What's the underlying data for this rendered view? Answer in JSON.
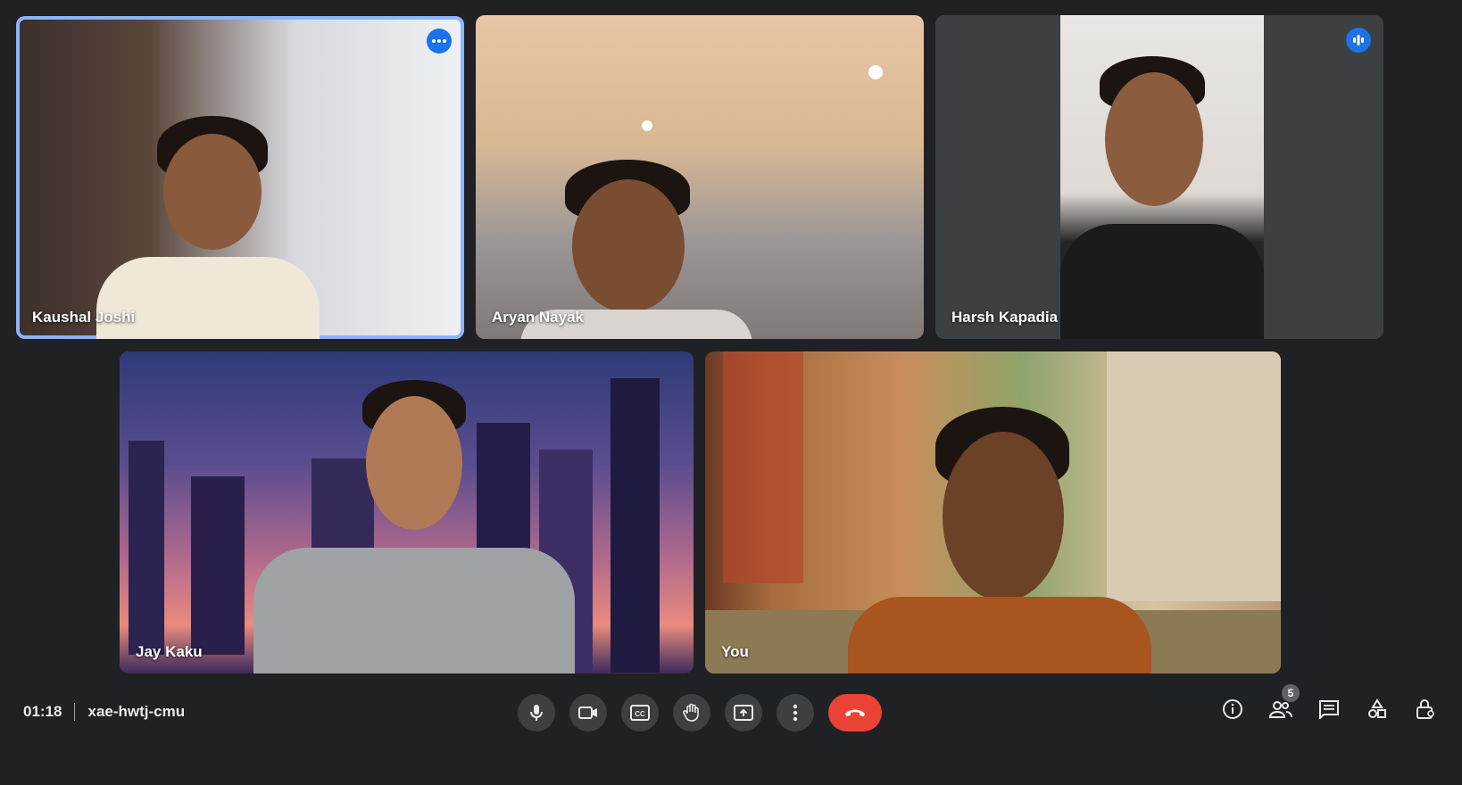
{
  "participants": [
    {
      "name": "Kaushal Joshi"
    },
    {
      "name": "Aryan Nayak"
    },
    {
      "name": "Harsh Kapadia"
    },
    {
      "name": "Jay Kaku"
    },
    {
      "name": "You"
    }
  ],
  "meeting": {
    "time": "01:18",
    "code": "xae-hwtj-cmu"
  },
  "controls": [
    "microphone-icon",
    "camera-icon",
    "captions-icon",
    "raise-hand-icon",
    "present-screen-icon",
    "more-options-icon",
    "end-call-icon"
  ],
  "right_panel": {
    "people_count": "5"
  },
  "colors": {
    "accent": "#8ab4f8",
    "end_call": "#ea4335",
    "background": "#202124"
  }
}
